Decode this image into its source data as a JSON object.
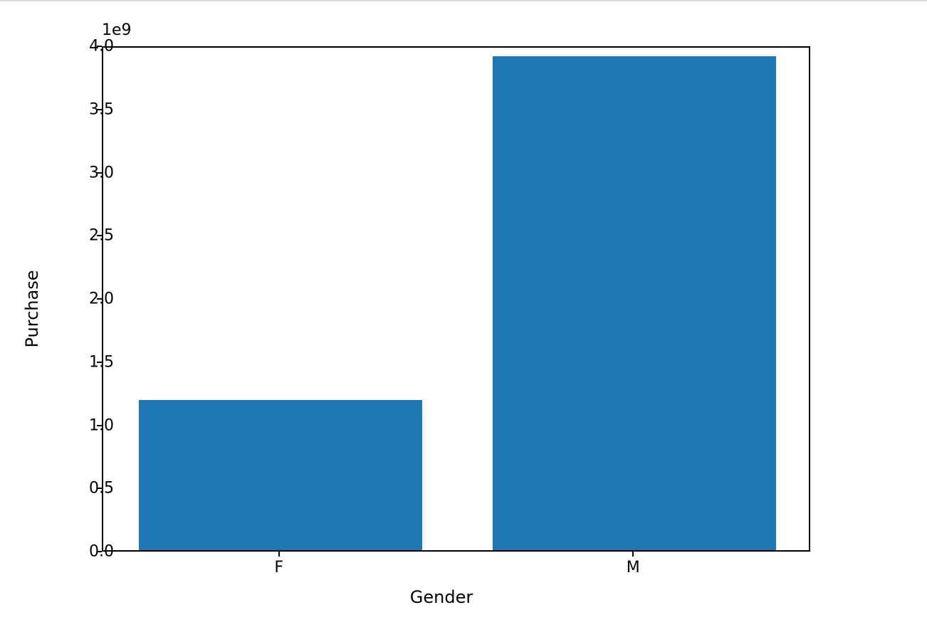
{
  "chart_data": {
    "type": "bar",
    "categories": [
      "F",
      "M"
    ],
    "values": [
      1190000000.0,
      3910000000.0
    ],
    "xlabel": "Gender",
    "ylabel": "Purchase",
    "ylim": [
      0,
      4000000000.0
    ],
    "y_ticks": [
      0.0,
      0.5,
      1.0,
      1.5,
      2.0,
      2.5,
      3.0,
      3.5,
      4.0
    ],
    "y_tick_labels": [
      "0.0",
      "0.5",
      "1.0",
      "1.5",
      "2.0",
      "2.5",
      "3.0",
      "3.5",
      "4.0"
    ],
    "offset_text": "1e9",
    "bar_color": "#1f77b4"
  }
}
